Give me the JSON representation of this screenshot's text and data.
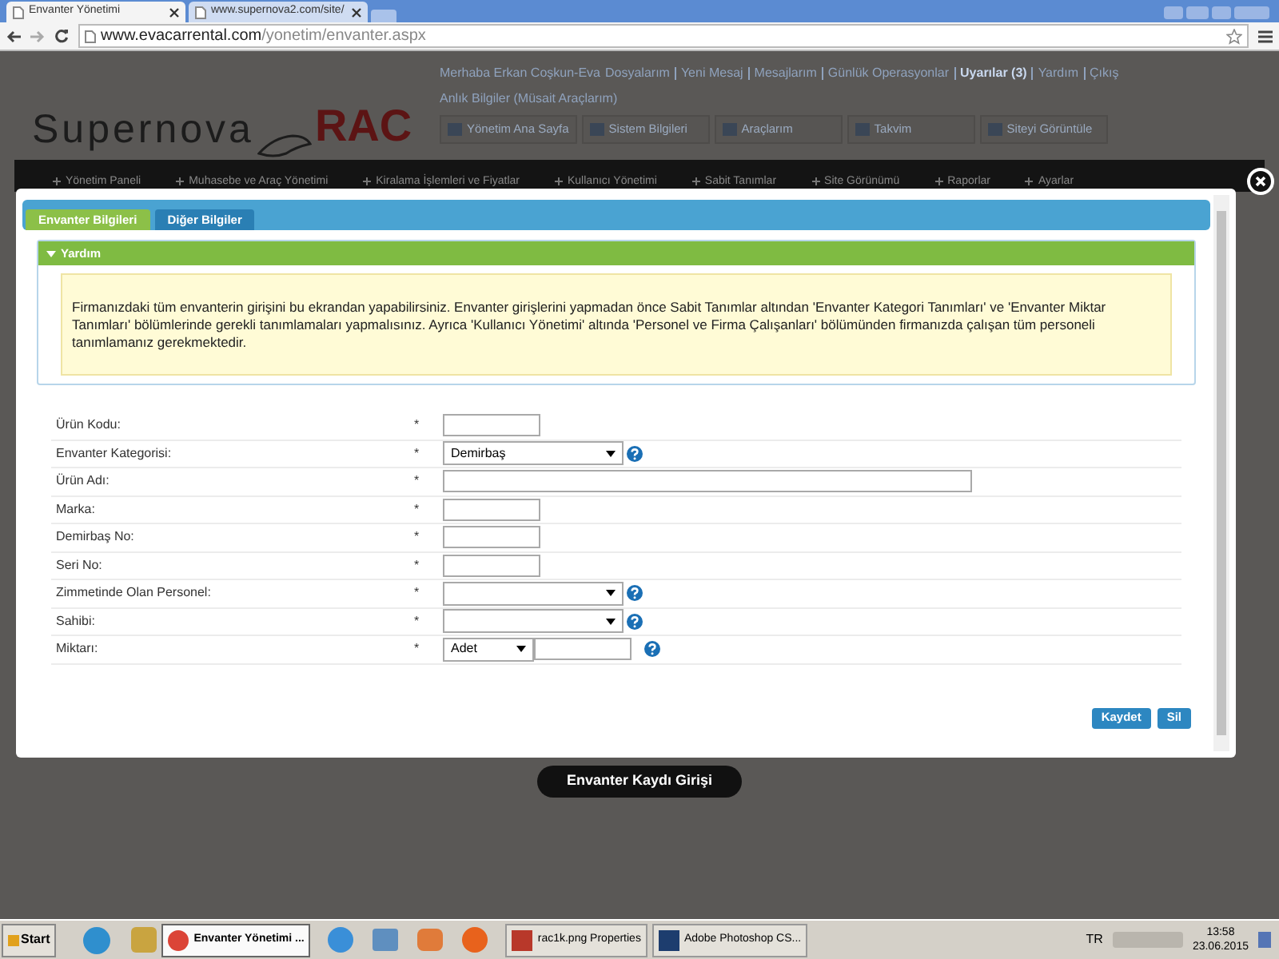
{
  "browser": {
    "tabs": [
      {
        "title": "Envanter Yönetimi",
        "selected": true
      },
      {
        "title": "www.supernova2.com/site/",
        "selected": false
      }
    ],
    "url_host": "www.evacarrental.com",
    "url_path": "/yonetim/envanter.aspx"
  },
  "site": {
    "logo_left": "Supernova",
    "logo_right": "RAC",
    "greeting": "Merhaba Erkan Coşkun-Eva",
    "top_links": [
      {
        "label": "Dosyalarım",
        "highlight": false
      },
      {
        "label": "Yeni Mesaj",
        "highlight": false
      },
      {
        "label": "Mesajlarım",
        "highlight": false
      },
      {
        "label": "Günlük Operasyonlar",
        "highlight": false
      },
      {
        "label": "Uyarılar (3)",
        "highlight": true
      },
      {
        "label": "Yardım",
        "highlight": false
      },
      {
        "label": "Çıkış",
        "highlight": false
      }
    ],
    "info_link": "Anlık Bilgiler (Müsait Araçlarım)",
    "nav_buttons": [
      "Yönetim Ana Sayfa",
      "Sistem Bilgileri",
      "Araçlarım",
      "Takvim",
      "Siteyi Görüntüle"
    ],
    "menu": [
      "Yönetim Paneli",
      "Muhasebe ve Araç Yönetimi",
      "Kiralama İşlemleri ve Fiyatlar",
      "Kullanıcı Yönetimi",
      "Sabit Tanımlar",
      "Site Görünümü",
      "Raporlar",
      "Ayarlar"
    ]
  },
  "modal": {
    "tabs": [
      {
        "label": "Envanter Bilgileri",
        "selected": true
      },
      {
        "label": "Diğer Bilgiler",
        "selected": false
      }
    ],
    "help": {
      "title": "Yardım",
      "expanded": true,
      "text": "Firmanızdaki tüm envanterin girişini bu ekrandan yapabilirsiniz. Envanter girişlerini yapmadan önce Sabit Tanımlar altından 'Envanter Kategori Tanımları' ve 'Envanter Miktar Tanımları' bölümlerinde gerekli tanımlamaları yapmalısınız. Ayrıca 'Kullanıcı Yönetimi' altında 'Personel ve Firma Çalışanları' bölümünden firmanızda çalışan tüm personeli tanımlamanız gerekmektedir."
    },
    "fields": [
      {
        "label": "Ürün Kodu:",
        "required": "*",
        "kind": "short",
        "help": false
      },
      {
        "label": "Envanter Kategorisi:",
        "required": "*",
        "kind": "select",
        "value": "Demirbaş",
        "help": true
      },
      {
        "label": "Ürün Adı:",
        "required": "*",
        "kind": "long",
        "help": false
      },
      {
        "label": "Marka:",
        "required": "*",
        "kind": "short",
        "help": false
      },
      {
        "label": "Demirbaş No:",
        "required": "*",
        "kind": "short",
        "help": false
      },
      {
        "label": "Seri No:",
        "required": "*",
        "kind": "short",
        "help": false
      },
      {
        "label": "Zimmetinde Olan Personel:",
        "required": "*",
        "kind": "select",
        "help": true
      },
      {
        "label": "Sahibi:",
        "required": "*",
        "kind": "select",
        "help": true
      },
      {
        "label": "Miktarı:",
        "required": "*",
        "kind": "quantity",
        "value": "Adet",
        "help": true
      }
    ],
    "buttons": [
      "Kaydet",
      "Sil"
    ]
  },
  "caption": "Envanter Kaydı Girişi",
  "taskbar": {
    "start": "Start",
    "tasks": [
      {
        "title": "Envanter Yönetimi ...",
        "selected": true
      },
      {
        "title": "rac1k.png Properties",
        "selected": false
      },
      {
        "title": "Adobe Photoshop CS...",
        "selected": false
      }
    ],
    "language": "TR",
    "time": "13:58",
    "date": "23.06.2015"
  }
}
